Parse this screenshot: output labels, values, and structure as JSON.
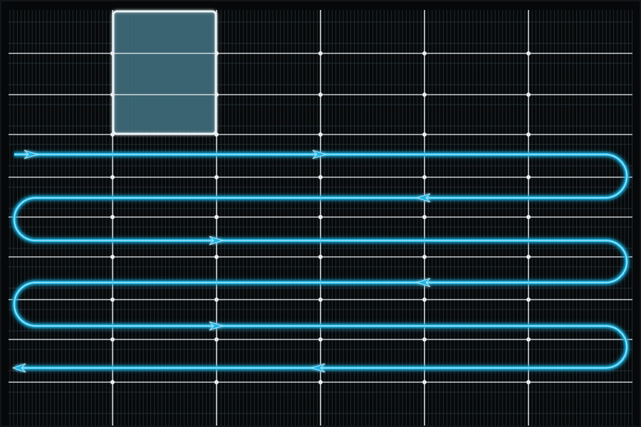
{
  "panel": {
    "colors": {
      "background": "#060809",
      "cell_line": "#3a4650",
      "grid_white": "#e9eef2",
      "flow": "#1fb6e6",
      "flow_glow": "#1aa8d8",
      "highlight_fill": "#3c6a78",
      "highlight_border": "#e8f4f8",
      "frame": "#121619"
    },
    "layout_hint": {
      "columns": 6,
      "rows": 10,
      "highlighted_cell": {
        "column": 2,
        "rows": [
          1,
          3
        ]
      },
      "flow_passes": 6,
      "flow_direction_start": "left-to-right",
      "flow_direction_end": "right-to-left"
    }
  }
}
